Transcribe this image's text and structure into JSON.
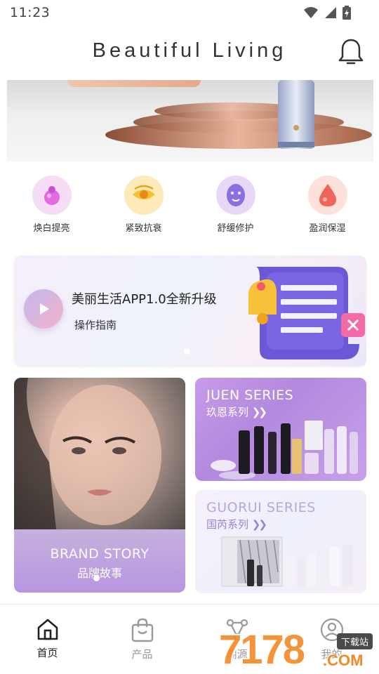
{
  "status_bar": {
    "time": "11:23",
    "icons": [
      "wifi-icon",
      "signal-icon",
      "battery-icon"
    ]
  },
  "header": {
    "title": "Beautiful Living",
    "bell_icon": "bell-icon"
  },
  "categories": [
    {
      "label": "焕白提亮",
      "icon": "brighten-icon",
      "color": "#f3d4f3"
    },
    {
      "label": "紧致抗衰",
      "icon": "eye-icon",
      "color": "#fbe6b0"
    },
    {
      "label": "舒缓修护",
      "icon": "mask-icon",
      "color": "#e4d6f5"
    },
    {
      "label": "盈润保湿",
      "icon": "drop-icon",
      "color": "#fbdcd6"
    }
  ],
  "upgrade_card": {
    "title": "美丽生活APP1.0全新升级",
    "subtitle": "操作指南"
  },
  "brand_story": {
    "en": "BRAND STORY",
    "cn": "品牌故事"
  },
  "juen_series": {
    "en": "JUEN SERIES",
    "cn": "玖恩系列"
  },
  "guorui_series": {
    "en": "GUORUI SERIES",
    "cn": "国芮系列"
  },
  "nav": [
    {
      "label": "首页",
      "icon": "home-icon",
      "active": true
    },
    {
      "label": "产品",
      "icon": "bag-icon",
      "active": false
    },
    {
      "label": "溯源",
      "icon": "trace-icon",
      "active": false
    },
    {
      "label": "我的",
      "icon": "profile-icon",
      "active": false
    }
  ],
  "watermark": {
    "number": "7178",
    "suffix": ".COM",
    "tag": "下载站"
  },
  "colors": {
    "accent": "#b48be0",
    "nav_active": "#222222",
    "nav_inactive": "#999999",
    "watermark": "#f28a2a"
  }
}
